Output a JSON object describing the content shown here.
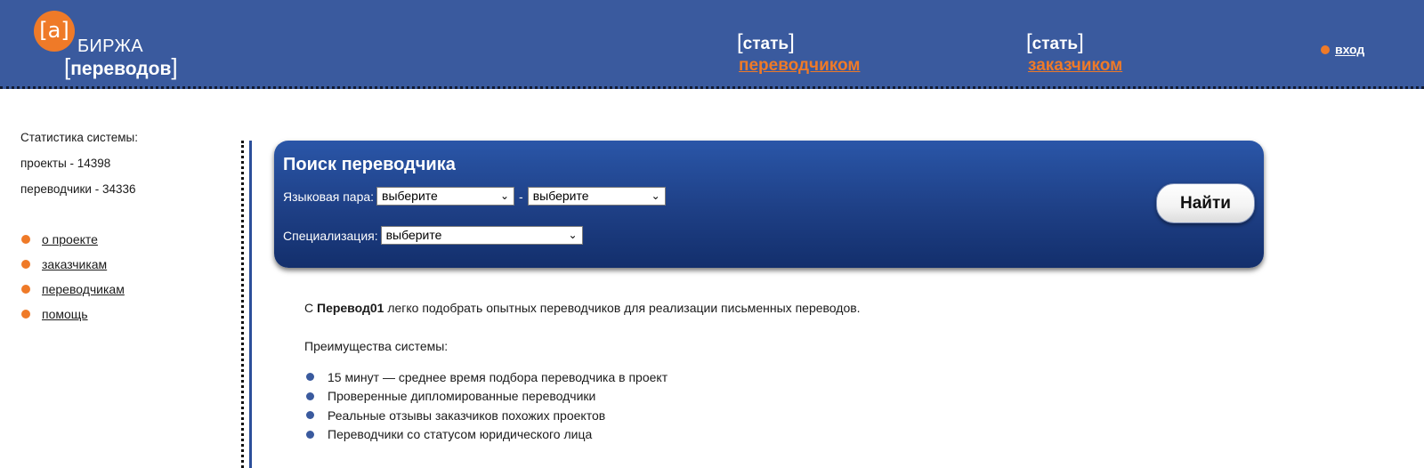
{
  "header": {
    "logo": {
      "symbol": "[a]",
      "line1": "БИРЖА",
      "line2": "переводов"
    },
    "promos": [
      {
        "top": "стать",
        "link": "переводчиком"
      },
      {
        "top": "стать",
        "link": "заказчиком"
      }
    ],
    "login": "вход"
  },
  "sidebar": {
    "stats": {
      "title": "Статистика системы:",
      "projects": "проекты - 14398",
      "translators": "переводчики - 34336"
    },
    "menu": [
      "о проекте",
      "заказчикам",
      "переводчикам",
      "помощь"
    ]
  },
  "search": {
    "title": "Поиск переводчика",
    "language_pair_label": "Языковая пара:",
    "from_value": "выберите",
    "dash": "-",
    "to_value": "выберите",
    "specialization_label": "Специализация:",
    "specialization_value": "выберите",
    "find_button": "Найти"
  },
  "content": {
    "intro_prefix": "С ",
    "intro_brand": "Перевод01",
    "intro_rest": " легко подобрать опытных переводчиков для реализации письменных переводов.",
    "advantages_title": "Преимущества системы:",
    "advantages": [
      "15 минут — среднее время подбора переводчика в проект",
      "Проверенные дипломированные переводчики",
      "Реальные отзывы заказчиков похожих проектов",
      "Переводчики со статусом юридического лица"
    ]
  },
  "colors": {
    "header_bg": "#3a5a9e",
    "accent_orange": "#ef7a28",
    "panel_blue": "#1e3f85"
  }
}
